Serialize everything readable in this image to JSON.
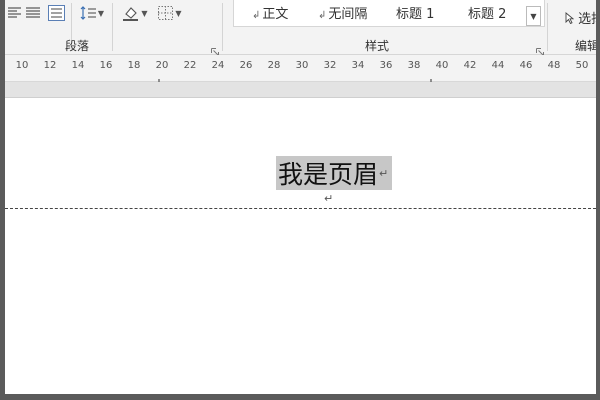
{
  "ribbon": {
    "paragraph_group_label": "段落",
    "styles_group_label": "样式",
    "editing_group_label": "编辑",
    "styles": [
      {
        "label": "正文"
      },
      {
        "label": "无间隔"
      },
      {
        "label": "标题 1"
      },
      {
        "label": "标题 2"
      }
    ],
    "style_mark": "↲",
    "select_label": "选择"
  },
  "ruler": {
    "ticks": [
      "10",
      "12",
      "14",
      "16",
      "18",
      "20",
      "22",
      "24",
      "26",
      "28",
      "30",
      "32",
      "34",
      "36",
      "38",
      "40",
      "42",
      "44",
      "46",
      "48",
      "50"
    ]
  },
  "document": {
    "header_text": "我是页眉",
    "paragraph_mark": "↵"
  },
  "colors": {
    "ribbon_bg": "#f3f3f3",
    "selection_highlight": "#c7c7c7",
    "frame_border": "#5b5b5b"
  }
}
